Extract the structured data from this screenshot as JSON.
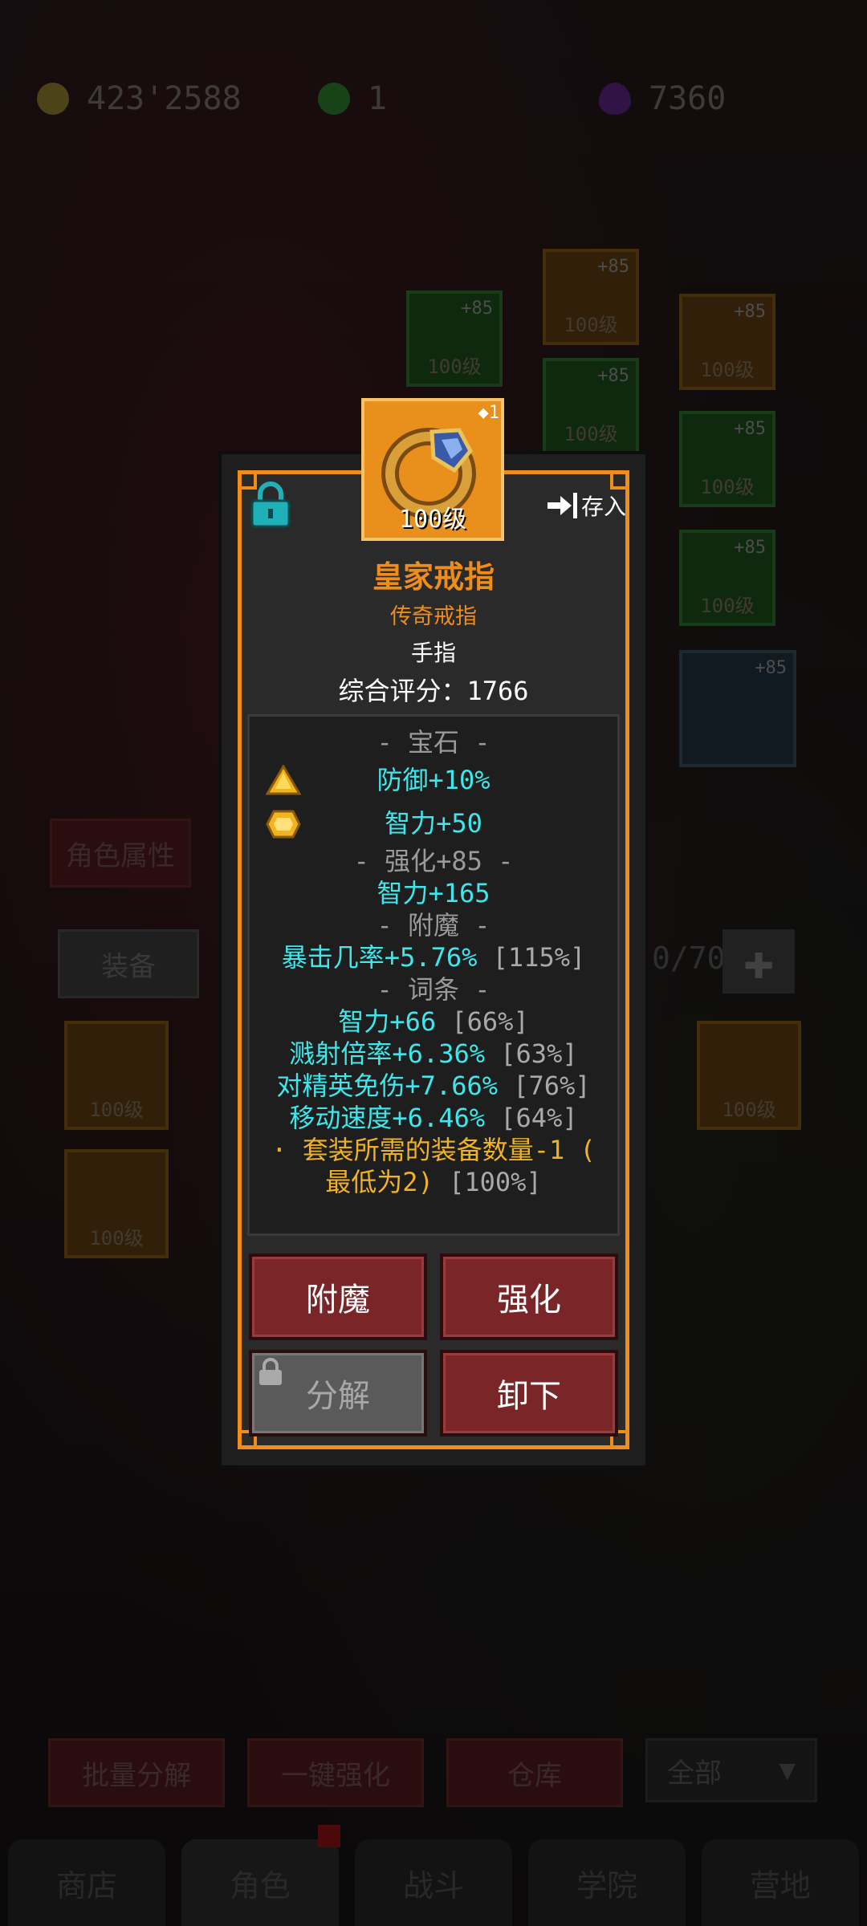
{
  "resources": [
    {
      "name": "gold",
      "value": "423'2588",
      "color": "#b89a3a"
    },
    {
      "name": "green-gem",
      "value": "1",
      "color": "#3a8a3a"
    },
    {
      "name": "purple-gem",
      "value": "7360",
      "color": "#6a2a8a"
    }
  ],
  "background": {
    "slot_level_label": "100级",
    "slot_plus_label": "+85",
    "menu_buttons": [
      "角色属性",
      "装备"
    ],
    "inventory_count": "0/70",
    "bottom_buttons": [
      "批量分解",
      "一键强化",
      "仓库"
    ],
    "filter": "全部",
    "tabs": [
      "商店",
      "角色",
      "战斗",
      "学院",
      "营地"
    ]
  },
  "item": {
    "level": "100级",
    "badge_count": "1",
    "store_label": "存入",
    "name": "皇家戒指",
    "rarity": "传奇戒指",
    "slot": "手指",
    "score_label": "综合评分：1766"
  },
  "stats": {
    "gem_header": "- 宝石 -",
    "gems": [
      {
        "icon": "topaz-triangle-icon",
        "text": "防御+10%"
      },
      {
        "icon": "topaz-hexagon-icon",
        "text": "智力+50"
      }
    ],
    "enhance_header": "- 强化+85 -",
    "enhance_line": "智力+165",
    "enchant_header": "- 附魔 -",
    "enchant_line": "暴击几率+5.76%",
    "enchant_pct": "[115%]",
    "affix_header": "- 词条 -",
    "affixes": [
      {
        "text": "智力+66",
        "pct": "[66%]"
      },
      {
        "text": "溅射倍率+6.36%",
        "pct": "[63%]"
      },
      {
        "text": "对精英免伤+7.66%",
        "pct": "[76%]"
      },
      {
        "text": "移动速度+6.46%",
        "pct": "[64%]"
      }
    ],
    "set_line1": "· 套装所需的装备数量-1 (",
    "set_line2": "最低为2)",
    "set_pct": "[100%]"
  },
  "actions": {
    "enchant": "附魔",
    "enhance": "强化",
    "dismantle": "分解",
    "unequip": "卸下"
  }
}
